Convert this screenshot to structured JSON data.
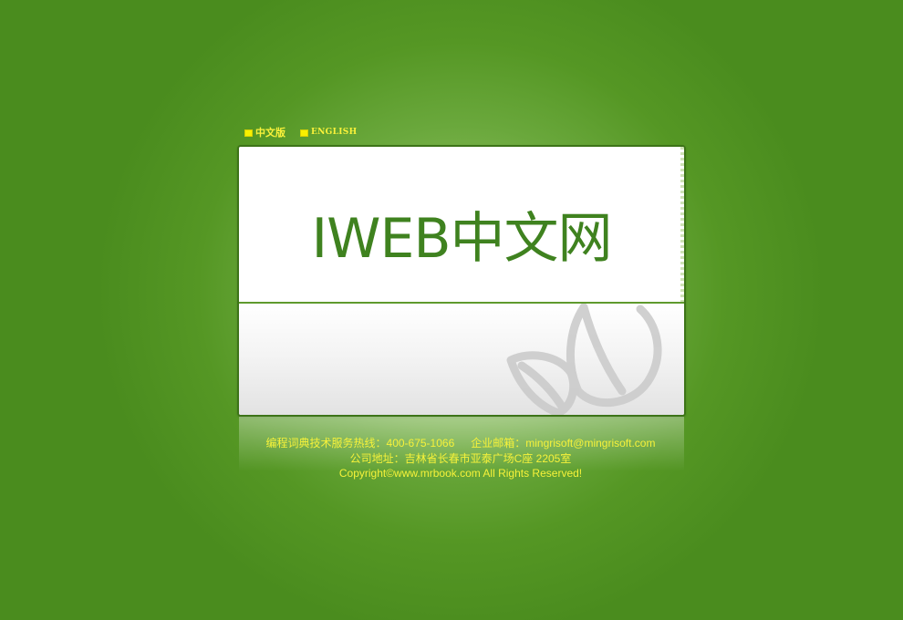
{
  "languages": [
    {
      "label": "中文版"
    },
    {
      "label": "ENGLISH"
    }
  ],
  "banner": {
    "title": "IWEB中文网"
  },
  "footer": {
    "hotline_label": "编程词典技术服务热线：400-675-1066",
    "email_label": "企业邮箱：mingrisoft@mingrisoft.com",
    "address": "公司地址：吉林省长春市亚泰广场C座 2205室",
    "copyright": "Copyright©www.mrbook.com All Rights Reserved!"
  },
  "colors": {
    "background": "#4a8c1e",
    "highlight": "#a7cf80",
    "brand_text": "#3f821f",
    "footer_text": "#f6f23a",
    "lang_square": "#f7f000"
  },
  "icons": {
    "lang_marker": "yellow-square",
    "decoration": "leaf-outline"
  }
}
